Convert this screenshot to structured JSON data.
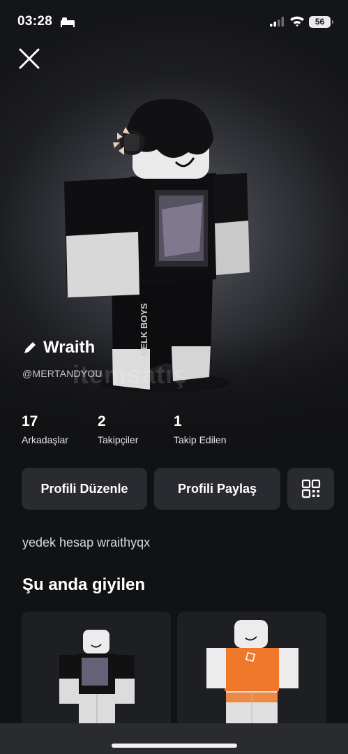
{
  "status_bar": {
    "time": "03:28",
    "battery": "56"
  },
  "profile": {
    "display_name": "Wraith",
    "username": "@MERTANDYOU",
    "watermark": "itemsatış"
  },
  "stats": [
    {
      "value": "17",
      "label": "Arkadaşlar"
    },
    {
      "value": "2",
      "label": "Takipçiler"
    },
    {
      "value": "1",
      "label": "Takip Edilen"
    }
  ],
  "actions": {
    "edit_profile": "Profili Düzenle",
    "share_profile": "Profili Paylaş"
  },
  "bio": "yedek hesap wraithyqx",
  "wearing": {
    "title": "Şu anda giyilen"
  },
  "avatar_shirt_text": "NELK BOYS",
  "colors": {
    "background": "#111214",
    "button": "#2a2b30",
    "card": "#1e1f23",
    "accent_orange": "#f0782a"
  }
}
